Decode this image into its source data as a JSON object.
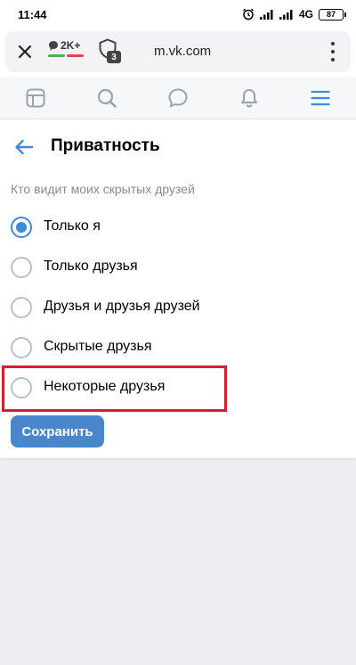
{
  "status_bar": {
    "time": "11:44",
    "network": "4G",
    "battery": "87"
  },
  "browser": {
    "chat_count": "2K+",
    "shield_count": "3",
    "url": "m.vk.com",
    "icons": [
      "close-icon",
      "chat-bubble-icon",
      "shield-icon",
      "more-vertical-icon"
    ]
  },
  "vk_nav": {
    "icons": [
      "news-icon",
      "search-icon",
      "messages-icon",
      "notifications-icon",
      "menu-icon"
    ],
    "active_color": "#3f8ae0"
  },
  "page": {
    "title": "Приватность",
    "section_title": "Кто видит моих скрытых друзей",
    "options": [
      {
        "label": "Только я",
        "checked": true
      },
      {
        "label": "Только друзья",
        "checked": false
      },
      {
        "label": "Друзья и друзья друзей",
        "checked": false
      },
      {
        "label": "Скрытые друзья",
        "checked": false
      },
      {
        "label": "Некоторые друзья",
        "checked": false
      }
    ],
    "save_label": "Сохранить"
  },
  "colors": {
    "accent": "#3f8ae0",
    "button": "#4986cc",
    "highlight": "#d81e2c",
    "background": "#ebedf0"
  }
}
